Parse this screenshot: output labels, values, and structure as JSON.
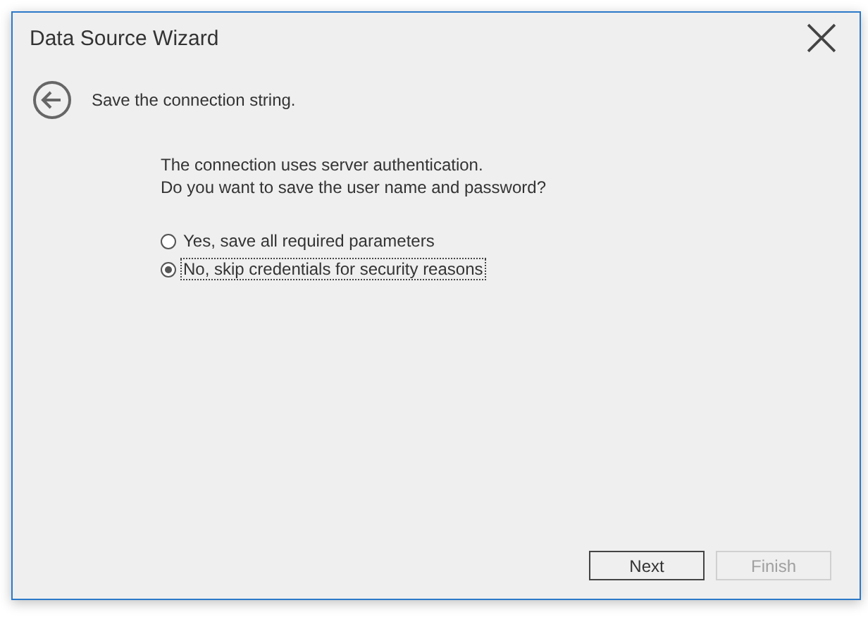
{
  "window": {
    "title": "Data Source Wizard"
  },
  "header": {
    "text": "Save the connection string."
  },
  "question": {
    "lines": [
      "The connection uses server authentication.",
      "Do you want to save the user name and password?"
    ]
  },
  "options": [
    {
      "label": "Yes, save all required parameters",
      "selected": false,
      "focused": false
    },
    {
      "label": "No, skip credentials for security reasons",
      "selected": true,
      "focused": true
    }
  ],
  "buttons": [
    {
      "label": "Next",
      "disabled": false
    },
    {
      "label": "Finish",
      "disabled": true
    }
  ]
}
